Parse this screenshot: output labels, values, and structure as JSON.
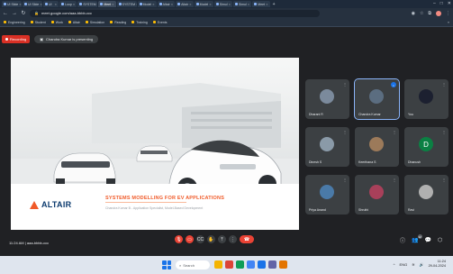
{
  "browser": {
    "tabs": [
      {
        "label": "UI Slide"
      },
      {
        "label": "UI Slide"
      },
      {
        "label": "UI"
      },
      {
        "label": "Loop"
      },
      {
        "label": "SYSTEM"
      },
      {
        "label": "Meet"
      },
      {
        "label": "SYSTEM"
      },
      {
        "label": "Model"
      },
      {
        "label": "Altair"
      },
      {
        "label": "Altair"
      },
      {
        "label": "Model"
      },
      {
        "label": "Simul"
      },
      {
        "label": "Simul"
      },
      {
        "label": "Meet"
      }
    ],
    "active_tab_index": 5,
    "new_tab": "+",
    "url": "meet.google.com/aaa-bbbb-ccc",
    "bookmarks": [
      "Engineering",
      "Student",
      "Work",
      "Altair",
      "Simulation",
      "Reading",
      "Training",
      "Events"
    ],
    "bookmarks_more": "»"
  },
  "meet": {
    "recording_label": "Recording",
    "presenting_label": "Chandra Kumar is presenting",
    "time_text": "11:24 AM  |  aaa-bbbb-ccc",
    "slide": {
      "logo_text": "ALTAIR",
      "title": "SYSTEMS MODELLING FOR EV APPLICATIONS",
      "subtitle": "Chandra Kumar B - Application Specialist, Model-Based Development"
    },
    "participants": [
      {
        "name": "Dharani R",
        "avatar": "photo",
        "color": "#7b8a9c"
      },
      {
        "name": "Chandra Kumar",
        "avatar": "photo",
        "color": "#5b6d80",
        "speaking": true
      },
      {
        "name": "You",
        "avatar": "photo",
        "color": "#1c2030"
      },
      {
        "name": "Dinesh S",
        "avatar": "photo",
        "color": "#8a9aa8"
      },
      {
        "name": "Keerthana S",
        "avatar": "photo",
        "color": "#9c7a5a"
      },
      {
        "name": "Dhanush",
        "avatar": "letter",
        "letter": "D",
        "color": "#0b8043"
      },
      {
        "name": "Priya Anand",
        "avatar": "photo",
        "color": "#4a7aa8"
      },
      {
        "name": "Shruthi",
        "avatar": "photo",
        "color": "#a8405a"
      },
      {
        "name": "Ravi",
        "avatar": "photo",
        "color": "#b0b0b0"
      }
    ],
    "controls": [
      {
        "name": "mic",
        "glyph": "🎙"
      },
      {
        "name": "camera",
        "glyph": "▭"
      },
      {
        "name": "captions",
        "glyph": "CC"
      },
      {
        "name": "raise-hand",
        "glyph": "✋"
      },
      {
        "name": "present",
        "glyph": "⤒"
      },
      {
        "name": "more",
        "glyph": "⋮"
      },
      {
        "name": "end-call",
        "glyph": "☎"
      }
    ],
    "right_controls": [
      {
        "name": "info",
        "glyph": "ⓘ"
      },
      {
        "name": "people",
        "glyph": "👥",
        "count": "12"
      },
      {
        "name": "chat",
        "glyph": "💬"
      },
      {
        "name": "activities",
        "glyph": "⬡"
      }
    ]
  },
  "taskbar": {
    "search_label": "Search",
    "apps": [
      {
        "name": "file-explorer",
        "color": "#f4b400"
      },
      {
        "name": "chrome",
        "color": "#db4437"
      },
      {
        "name": "edge",
        "color": "#0f9d58"
      },
      {
        "name": "store",
        "color": "#4285f4"
      },
      {
        "name": "mail",
        "color": "#1a73e8"
      },
      {
        "name": "teams",
        "color": "#6264a7"
      },
      {
        "name": "photos",
        "color": "#e37400"
      }
    ],
    "time": "11:24",
    "date": "29-04-2024",
    "lang": "ENG"
  },
  "colors": {
    "recording": "#d93025",
    "accent": "#f05a28",
    "brand_navy": "#0b3a6e",
    "end_call": "#ea4335"
  }
}
